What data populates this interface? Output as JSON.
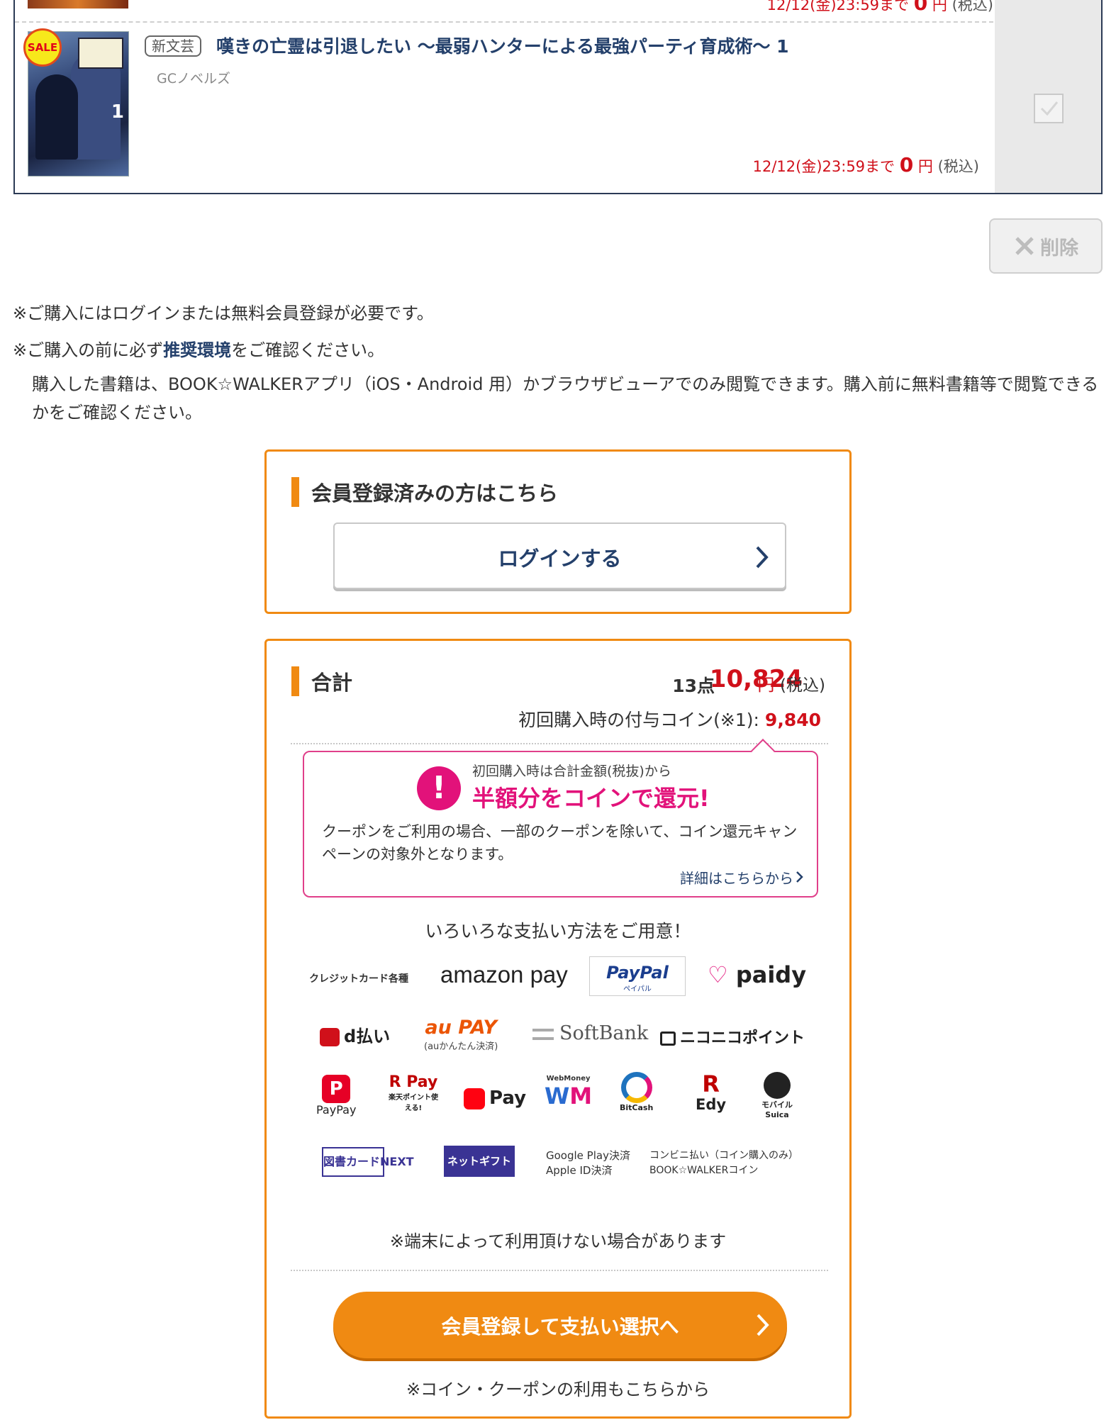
{
  "cart": {
    "prev_item": {
      "deadline": "12/12(金)23:59まで",
      "price": "0",
      "unit": "円",
      "tax": "(税込)"
    },
    "item": {
      "sale_badge": "SALE",
      "genre": "新文芸",
      "title": "嘆きの亡霊は引退したい 〜最弱ハンターによる最強パーティ育成術〜 1",
      "label": "GCノベルズ",
      "deadline": "12/12(金)23:59まで",
      "price": "0",
      "unit": "円",
      "tax": "(税込)",
      "cover_number": "1"
    },
    "delete_label": "削除"
  },
  "notes": {
    "login_required": "※ご購入にはログインまたは無料会員登録が必要です。",
    "env_prefix": "※ご購入の前に必ず",
    "env_link": "推奨環境",
    "env_suffix": "をご確認ください。",
    "paragraph": "購入した書籍は、BOOK☆WALKERアプリ（iOS・Android 用）かブラウザビューアでのみ閲覧できます。購入前に無料書籍等で閲覧できるかをご確認ください。"
  },
  "login_panel": {
    "heading": "会員登録済みの方はこちら",
    "button": "ログインする"
  },
  "total_panel": {
    "heading": "合計",
    "count": "13点",
    "amount": "10,824",
    "unit": "円",
    "tax": "(税込)",
    "coin_label": "初回購入時の付与コイン(※1):",
    "coin_value": "9,840",
    "campaign": {
      "lead": "初回購入時は合計金額(税抜)から",
      "headline": "半額分をコインで還元!",
      "body": "クーポンをご利用の場合、一部のクーポンを除いて、コイン還元キャンペーンの対象外となります。",
      "detail": "詳細はこちらから"
    },
    "payment_title": "いろいろな支払い方法をご用意！",
    "payments": {
      "credit": "クレジットカード各種",
      "amazon": "amazon pay",
      "paypal": "PayPal",
      "paypal_sub": "ペイパル",
      "paidy": "paidy",
      "dbarai": "d払い",
      "aupay": "au PAY",
      "aupay_sub": "(auかんたん決済)",
      "softbank": "SoftBank",
      "niconico": "ニコニコポイント",
      "paypay": "PayPay",
      "rpay": "R Pay",
      "rpay_sub": "楽天ポイント使える!",
      "merpay": "Pay",
      "webmoney": "WebMoney",
      "bitcash": "BitCash",
      "edy": "Edy",
      "suica": "モバイルSuica",
      "toshocard": "図書カードNEXT",
      "toshogift": "ネットギフト",
      "google": "Google Play決済",
      "apple": "Apple ID決済",
      "konbini": "コンビニ払い（コイン購入のみ）",
      "bwcoin": "BOOK☆WALKERコイン"
    },
    "device_note": "※端末によって利用頂けない場合があります",
    "pay_button": "会員登録して支払い選択へ",
    "coupon_note": "※コイン・クーポンの利用もこちらから"
  },
  "colors": {
    "accent": "#f08a12",
    "price_red": "#d0101a",
    "link_navy": "#24406b",
    "campaign_pink": "#e2127a"
  }
}
